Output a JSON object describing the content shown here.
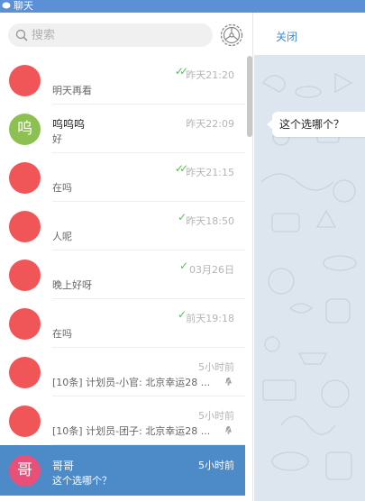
{
  "window": {
    "title": "聊天"
  },
  "search": {
    "placeholder": "搜索"
  },
  "chat": {
    "close_label": "关闭",
    "bubble_text": "这个选哪个？"
  },
  "colors": {
    "accent": "#4d8bc8",
    "avatar_red": "#f05557",
    "avatar_green": "#8cc152",
    "avatar_pink": "#e8507a",
    "check_green": "#55c35a"
  },
  "conversations": [
    {
      "avatar": "",
      "name": "",
      "message": "明天再看",
      "time": "昨天21:20",
      "status": "read",
      "muted": false,
      "selected": false
    },
    {
      "avatar": "呜",
      "name": "呜呜呜",
      "message": "好",
      "time": "昨天22:09",
      "status": "",
      "muted": false,
      "selected": false
    },
    {
      "avatar": "",
      "name": "",
      "message": "在吗",
      "time": "昨天21:15",
      "status": "read",
      "muted": false,
      "selected": false
    },
    {
      "avatar": "",
      "name": "",
      "message": "人呢",
      "time": "昨天18:50",
      "status": "sent",
      "muted": false,
      "selected": false
    },
    {
      "avatar": "",
      "name": "",
      "message": "晚上好呀",
      "time": "03月26日",
      "status": "sent",
      "muted": false,
      "selected": false
    },
    {
      "avatar": "",
      "name": "",
      "message": "在吗",
      "time": "前天19:18",
      "status": "sent",
      "muted": false,
      "selected": false
    },
    {
      "avatar": "",
      "name": "",
      "message": "[10条] 计划员-小官: 北京幸运28 ...",
      "time": "5小时前",
      "status": "",
      "muted": true,
      "selected": false
    },
    {
      "avatar": "",
      "name": "",
      "message": "[10条] 计划员-团子: 北京幸运28 ...",
      "time": "5小时前",
      "status": "",
      "muted": true,
      "selected": false
    },
    {
      "avatar": "哥",
      "name": "哥哥",
      "message": "这个选哪个？",
      "time": "5小时前",
      "status": "",
      "muted": false,
      "selected": true
    }
  ]
}
